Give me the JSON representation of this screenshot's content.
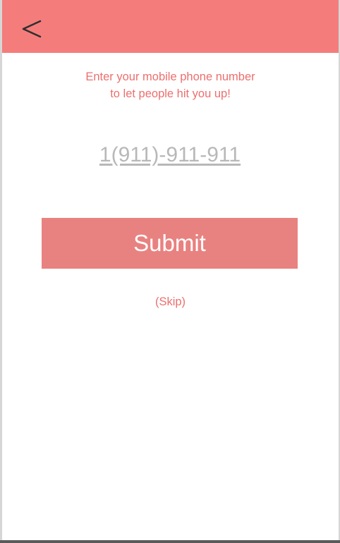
{
  "header": {
    "back_icon": "chevron-left-icon",
    "color": "#f47d7b"
  },
  "prompt": {
    "line1": "Enter your mobile phone number",
    "line2": "to let people hit you up!",
    "color": "#ec6f6e"
  },
  "phone_field": {
    "placeholder": "1(911)-911-911",
    "value": ""
  },
  "submit": {
    "label": "Submit",
    "color": "#e88280"
  },
  "skip": {
    "label": "(Skip)"
  }
}
